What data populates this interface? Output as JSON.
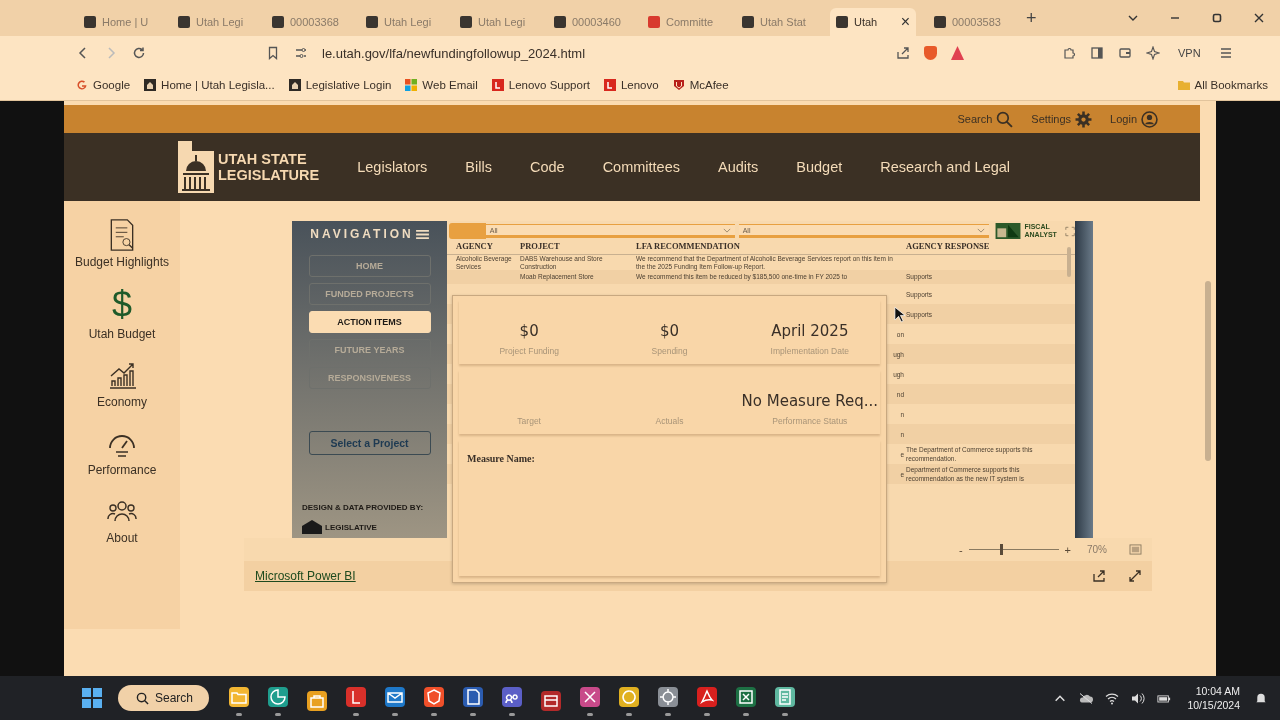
{
  "browser": {
    "tabs": [
      {
        "label": "Home | U",
        "color": "#3a3530",
        "selected": false
      },
      {
        "label": "Utah Legi",
        "color": "#3a3530",
        "selected": false
      },
      {
        "label": "00003368",
        "color": "#3a3530",
        "selected": false
      },
      {
        "label": "Utah Legi",
        "color": "#3a3530",
        "selected": false
      },
      {
        "label": "Utah Legi",
        "color": "#3a3530",
        "selected": false
      },
      {
        "label": "00003460",
        "color": "#3a3530",
        "selected": false
      },
      {
        "label": "Committe",
        "color": "#d83a2e",
        "selected": false
      },
      {
        "label": "Utah Stat",
        "color": "#3a3530",
        "selected": false
      },
      {
        "label": "Utah",
        "color": "#3a3530",
        "selected": true
      },
      {
        "label": "00003583",
        "color": "#3a3530",
        "selected": false
      }
    ],
    "close_tab": "×",
    "new_tab": "+",
    "address": "le.utah.gov/lfa/newfundingfollowup_2024.html",
    "vpn": "VPN",
    "bookmarks": [
      {
        "label": "Google",
        "kind": "google"
      },
      {
        "label": "Home | Utah Legisla...",
        "kind": "legislature"
      },
      {
        "label": "Legislative Login",
        "kind": "legislature"
      },
      {
        "label": "Web Email",
        "kind": "windows"
      },
      {
        "label": "Lenovo Support",
        "kind": "lenovo"
      },
      {
        "label": "Lenovo",
        "kind": "lenovo"
      },
      {
        "label": "McAfee",
        "kind": "shield"
      }
    ],
    "all_bookmarks": "All Bookmarks"
  },
  "site": {
    "utility": [
      {
        "label": "Search",
        "kind": "search"
      },
      {
        "label": "Settings",
        "kind": "settings"
      },
      {
        "label": "Login",
        "kind": "login"
      }
    ],
    "logo": [
      "UTAH STATE",
      "LEGISLATURE"
    ],
    "nav": [
      "Legislators",
      "Bills",
      "Code",
      "Committees",
      "Audits",
      "Budget",
      "Research and Legal"
    ]
  },
  "sidebar": [
    {
      "label": "Budget Highlights",
      "kind": "document"
    },
    {
      "label": "Utah Budget",
      "kind": "dollar",
      "glyph": "$"
    },
    {
      "label": "Economy",
      "kind": "chart"
    },
    {
      "label": "Performance",
      "kind": "gauge"
    },
    {
      "label": "About",
      "kind": "people"
    }
  ],
  "report": {
    "nav_title": "NAVIGATION",
    "nav_buttons": [
      {
        "label": "HOME",
        "selected": false
      },
      {
        "label": "FUNDED PROJECTS",
        "selected": false
      },
      {
        "label": "ACTION ITEMS",
        "selected": true
      },
      {
        "label": "FUTURE YEARS",
        "selected": false
      },
      {
        "label": "RESPONSIVENESS",
        "selected": false
      }
    ],
    "select_button": "Select a Project",
    "credit": "DESIGN & DATA PROVIDED BY:",
    "credit_logo": "LEGISLATIVE",
    "filters": [
      "All",
      "All"
    ],
    "analyst_logo": [
      "FISCAL",
      "ANALYST"
    ],
    "columns": [
      "AGENCY",
      "PROJECT",
      "LFA RECOMMENDATION",
      "AGENCY RESPONSE"
    ],
    "rows": [
      {
        "kind": "full",
        "agency": "Alcoholic Beverage Services",
        "project": "DABS Warehouse and Store Construction",
        "recommendation": "We recommend that the Department of Alcoholic Beverage Services report on this item in the the 2025 Funding Item Follow-up Report."
      },
      {
        "kind": "full",
        "project": "Moab Replacement Store",
        "recommendation": "We recommend this item be reduced by $185,500 one-time in FY 2025 to",
        "response": "Supports"
      },
      {
        "kind": "covered",
        "response": "Supports"
      },
      {
        "kind": "covered",
        "response": "Supports"
      },
      {
        "kind": "covered",
        "recommendation": "on"
      },
      {
        "kind": "covered",
        "recommendation": "ugh"
      },
      {
        "kind": "covered",
        "recommendation": "ugh"
      },
      {
        "kind": "covered",
        "recommendation": "nd"
      },
      {
        "kind": "covered",
        "recommendation": "n"
      },
      {
        "kind": "covered",
        "recommendation": "n"
      },
      {
        "kind": "covered",
        "recommendation": "e",
        "response": "The Department of Commerce supports this recommendation."
      },
      {
        "kind": "covered",
        "recommendation": "e",
        "response": "Department of Commerce supports this recommendation as the new IT system is"
      }
    ],
    "popup": {
      "cards": [
        [
          {
            "value": "$0",
            "label": "Project Funding"
          },
          {
            "value": "$0",
            "label": "Spending"
          },
          {
            "value": "April 2025",
            "label": "Implementation Date"
          }
        ],
        [
          {
            "label": "Target"
          },
          {
            "label": "Actuals"
          },
          {
            "value": "No Measure Req...",
            "label": "Performance Status"
          }
        ]
      ],
      "measure_label": "Measure Name:"
    },
    "zoom": {
      "minus": "-",
      "plus": "+",
      "level": 0.35,
      "reading": "70%"
    },
    "footer_link": "Microsoft Power BI"
  },
  "taskbar": {
    "search": "Search",
    "apps": [
      {
        "kind": "folder",
        "color": "#f2b632",
        "running": true
      },
      {
        "kind": "browser",
        "color": "#1f9e8e",
        "running": true
      },
      {
        "kind": "store",
        "color": "#e8a020",
        "running": false
      },
      {
        "kind": "letter-app",
        "color": "#d8302a",
        "running": true
      },
      {
        "kind": "mail",
        "color": "#1e78c8",
        "running": true
      },
      {
        "kind": "lion",
        "color": "#f0502a",
        "running": true
      },
      {
        "kind": "document",
        "color": "#2b5cb0",
        "running": true
      },
      {
        "kind": "people",
        "color": "#5b5fc7",
        "running": true
      },
      {
        "kind": "database",
        "color": "#b22a2a",
        "running": false
      },
      {
        "kind": "scissors",
        "color": "#c84a8a",
        "running": true
      },
      {
        "kind": "chrome",
        "color": "#e0b020",
        "running": true
      },
      {
        "kind": "gear",
        "color": "#8a8f96",
        "running": true
      },
      {
        "kind": "pdf",
        "color": "#d8201e",
        "running": true
      },
      {
        "kind": "sheet",
        "color": "#1d7044",
        "running": true
      },
      {
        "kind": "notepad",
        "color": "#5fb8a0",
        "running": true
      }
    ],
    "time": "10:04 AM",
    "date": "10/15/2024"
  }
}
